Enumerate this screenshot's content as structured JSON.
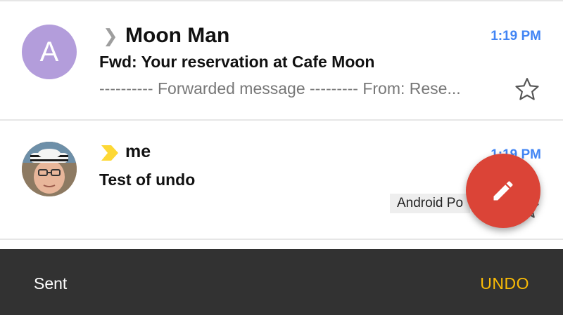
{
  "emails": [
    {
      "avatar_letter": "A",
      "sender": "Moon Man",
      "time": "1:19 PM",
      "subject": "Fwd: Your reservation at Cafe Moon",
      "snippet": "---------- Forwarded message --------- From: Rese..."
    },
    {
      "sender": "me",
      "time": "1:19 PM",
      "subject": "Test of undo",
      "label": "Android Po"
    }
  ],
  "snackbar": {
    "message": "Sent",
    "action": "UNDO"
  },
  "colors": {
    "accent_time": "#4285f4",
    "fab": "#db4437",
    "snackbar_action": "#fbbc05",
    "avatar_bg": "#b39ddb",
    "importance_marker_personal": "#fdd835"
  },
  "icons": {
    "importance_marker": "chevron-right-icon",
    "star": "star-outline-icon",
    "compose": "pencil-icon"
  }
}
